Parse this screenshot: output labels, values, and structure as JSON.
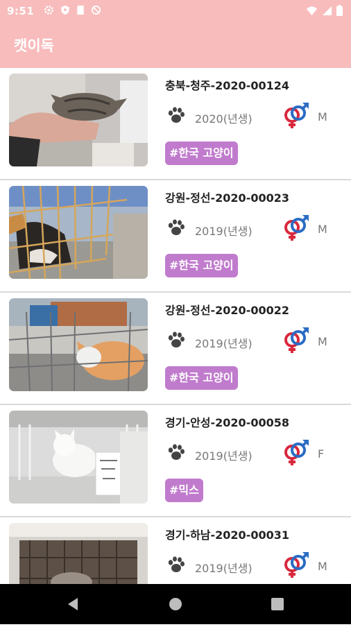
{
  "status_bar": {
    "time": "9:51"
  },
  "app": {
    "title": "캣이독"
  },
  "items": [
    {
      "title": "충북-청주-2020-00124",
      "year": "2020(년생)",
      "sex": "M",
      "tag": "#한국 고양이"
    },
    {
      "title": "강원-정선-2020-00023",
      "year": "2019(년생)",
      "sex": "M",
      "tag": "#한국 고양이"
    },
    {
      "title": "강원-정선-2020-00022",
      "year": "2019(년생)",
      "sex": "M",
      "tag": "#한국 고양이"
    },
    {
      "title": "경기-안성-2020-00058",
      "year": "2019(년생)",
      "sex": "F",
      "tag": "#믹스"
    },
    {
      "title": "경기-하남-2020-00031",
      "year": "2019(년생)",
      "sex": "M",
      "tag": ""
    }
  ],
  "colors": {
    "accent": "#f8bcbc",
    "tag": "#c07bcd",
    "male": "#2b6cc4",
    "female": "#d8283c"
  },
  "icons": {
    "nav_back": "back-triangle-icon",
    "nav_home": "home-circle-icon",
    "nav_recent": "recent-square-icon"
  }
}
